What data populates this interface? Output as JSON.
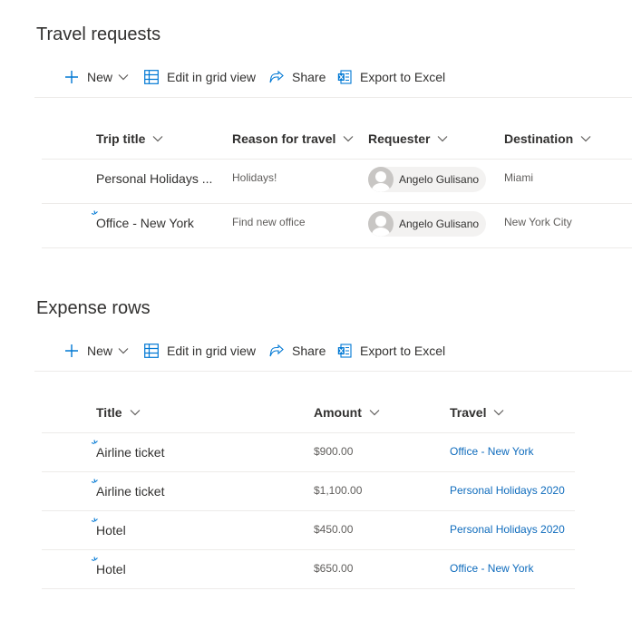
{
  "travel": {
    "title": "Travel requests",
    "commands": {
      "new": "New",
      "grid": "Edit in grid view",
      "share": "Share",
      "export": "Export to Excel"
    },
    "columns": [
      "Trip title",
      "Reason for travel",
      "Requester",
      "Destination"
    ],
    "rows": [
      {
        "title": "Personal Holidays ...",
        "reason": "Holidays!",
        "requester": "Angelo Gulisano",
        "destination": "Miami",
        "is_new": false
      },
      {
        "title": "Office - New York",
        "reason": "Find new office",
        "requester": "Angelo Gulisano",
        "destination": "New York City",
        "is_new": true
      }
    ]
  },
  "expense": {
    "title": "Expense rows",
    "commands": {
      "new": "New",
      "grid": "Edit in grid view",
      "share": "Share",
      "export": "Export to Excel"
    },
    "columns": [
      "Title",
      "Amount",
      "Travel"
    ],
    "rows": [
      {
        "title": "Airline ticket",
        "amount": "$900.00",
        "travel": "Office - New York",
        "is_new": true
      },
      {
        "title": "Airline ticket",
        "amount": "$1,100.00",
        "travel": "Personal Holidays 2020",
        "is_new": true
      },
      {
        "title": "Hotel",
        "amount": "$450.00",
        "travel": "Personal Holidays 2020",
        "is_new": true
      },
      {
        "title": "Hotel",
        "amount": "$650.00",
        "travel": "Office - New York",
        "is_new": true
      }
    ]
  },
  "colors": {
    "accent": "#0f6cbd",
    "icon": "#0078d4",
    "text": "#323130",
    "secondary_text": "#605e5c",
    "divider": "#edebe9"
  },
  "icons": {
    "new": "plus-icon",
    "grid": "grid-icon",
    "share": "share-icon",
    "export": "excel-icon",
    "sort": "chevron-down-icon",
    "new_item": "new-item-icon"
  }
}
